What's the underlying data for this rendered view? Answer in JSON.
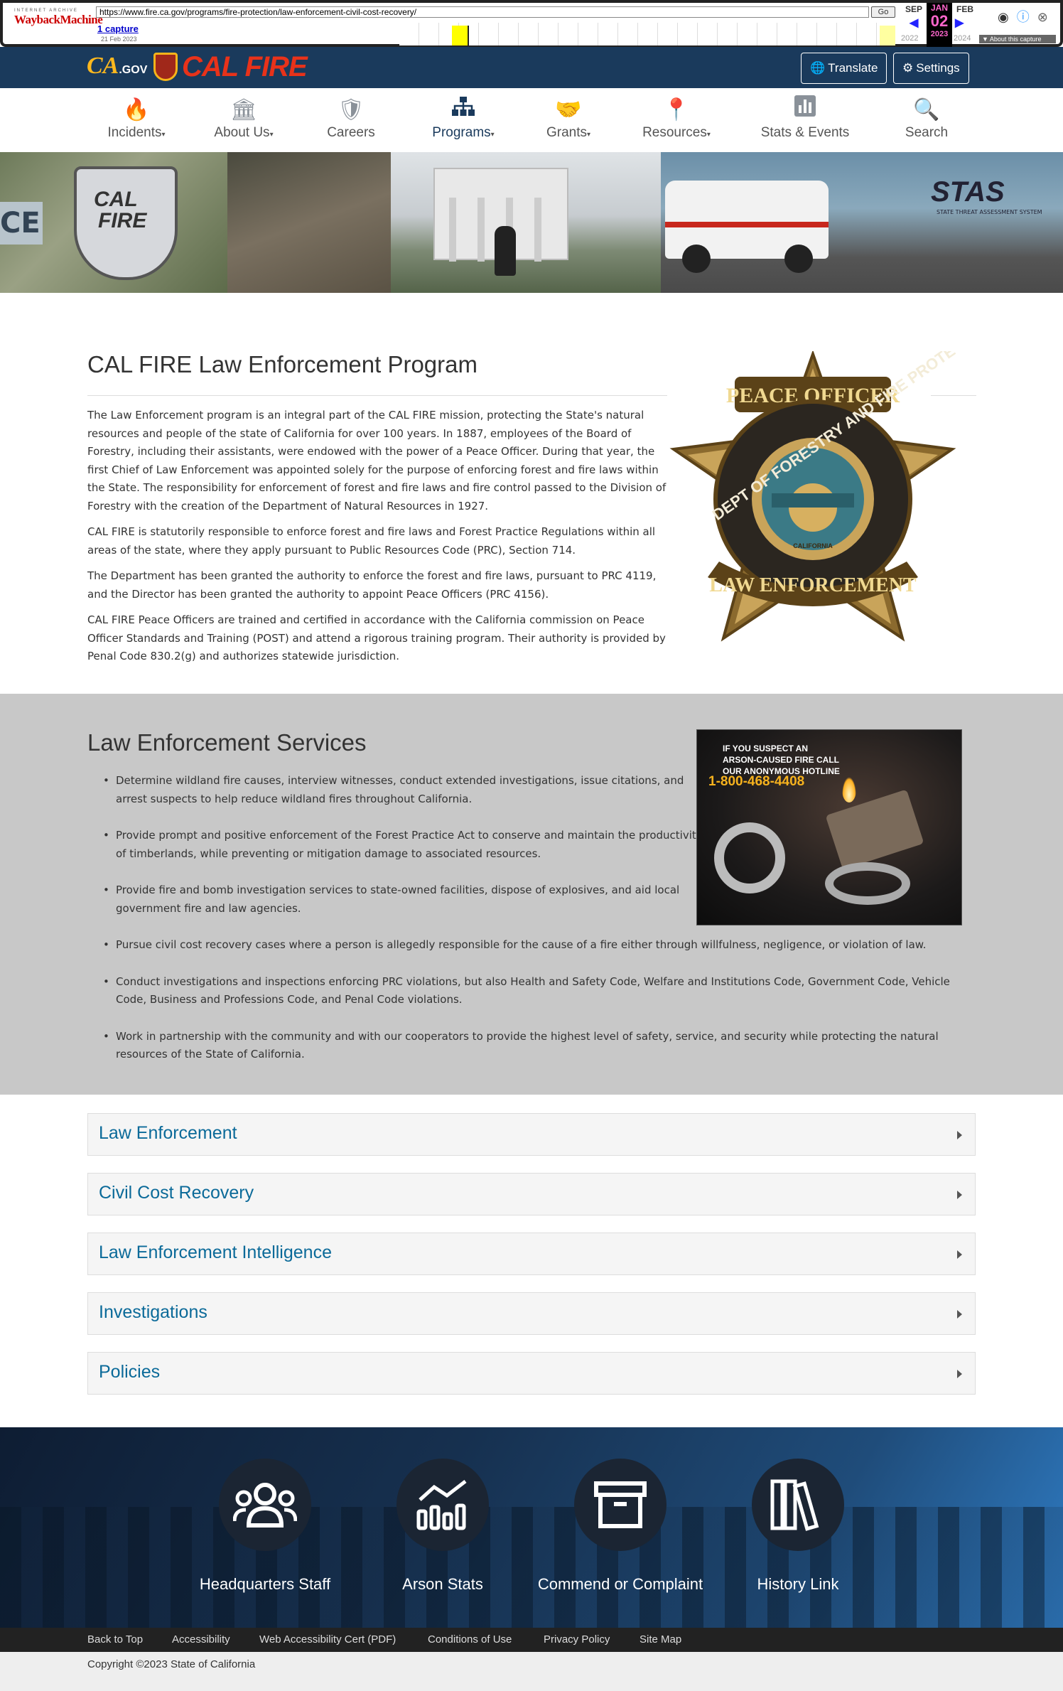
{
  "wayback": {
    "logo_top": "INTERNET ARCHIVE",
    "logo_main": "WaybackMachine",
    "url": "https://www.fire.ca.gov/programs/fire-protection/law-enforcement-civil-cost-recovery/",
    "go_label": "Go",
    "captures": "1 capture",
    "capture_date": "21 Feb 2023",
    "month_prev": "SEP",
    "month_current": "JAN",
    "day_current": "02",
    "month_next": "FEB",
    "year_prev": "2022",
    "year_current": "2023",
    "year_next": "2024",
    "about": "▼ About this capture"
  },
  "header": {
    "cagov": "CA",
    "cagov_suffix": ".GOV",
    "brand": "CAL FIRE",
    "translate_label": "Translate",
    "settings_label": "Settings"
  },
  "nav": {
    "items": [
      {
        "label": "Incidents",
        "caret": "▾",
        "icon": "flame-icon"
      },
      {
        "label": "About Us",
        "caret": "▾",
        "icon": "capitol-icon"
      },
      {
        "label": "Careers",
        "caret": "",
        "icon": "badge-icon"
      },
      {
        "label": "Programs",
        "caret": "▾",
        "icon": "sitemap-icon"
      },
      {
        "label": "Grants",
        "caret": "▾",
        "icon": "handshake-icon"
      },
      {
        "label": "Resources",
        "caret": "▾",
        "icon": "map-pin-icon"
      },
      {
        "label": "Stats & Events",
        "caret": "",
        "icon": "bar-chart-icon"
      },
      {
        "label": "Search",
        "caret": "",
        "icon": "search-icon"
      }
    ]
  },
  "banner": {
    "patch_line1": "CAL",
    "patch_line2": "FIRE",
    "ce": "CE",
    "stas": "STAS",
    "stas_sub": "STATE THREAT ASSESSMENT SYSTEM"
  },
  "intro": {
    "title": "CAL FIRE Law Enforcement Program",
    "paragraphs": [
      "The Law Enforcement program is an integral part of the CAL FIRE mission, protecting the State's natural resources and people of the state of California for over 100 years. In 1887, employees of the Board of Forestry, including their assistants, were endowed with the power of a Peace Officer. During that year, the first Chief of Law Enforcement was appointed solely for the purpose of enforcing forest and fire laws within the State. The responsibility for enforcement of forest and fire laws and fire control passed to the Division of Forestry with the creation of the Department of Natural Resources in 1927.",
      "CAL FIRE is statutorily responsible to enforce forest and fire laws and Forest Practice Regulations within all areas of the state, where they apply pursuant to Public Resources Code (PRC), Section 714.",
      "The Department has been granted the authority to enforce the forest and fire laws, pursuant to PRC 4119, and the Director has been granted the authority to appoint Peace Officers (PRC 4156).",
      "CAL FIRE Peace Officers are trained and certified in accordance with the California commission on Peace Officer Standards and Training (POST) and attend a rigorous training program. Their authority is provided by Penal Code 830.2(g) and authorizes statewide jurisdiction."
    ],
    "badge": {
      "top": "PEACE OFFICER",
      "ring_top": "DEPT OF FORESTRY AND FIRE PROTECTION",
      "bottom": "LAW ENFORCEMENT",
      "seal": "CALIFORNIA"
    }
  },
  "services": {
    "title": "Law Enforcement Services",
    "items": [
      "Determine wildland fire causes, interview witnesses, conduct extended investigations, issue citations, and arrest suspects to help reduce wildland fires throughout California.",
      "Provide prompt and positive enforcement of the Forest Practice Act to conserve and maintain the productivity of timberlands, while preventing or mitigation damage to associated resources.",
      "Provide fire and bomb investigation services to state-owned facilities, dispose of explosives, and aid local government fire and law agencies.",
      "Pursue civil cost recovery cases where a person is allegedly responsible for the cause of a fire either through willfulness, negligence, or violation of law.",
      "Conduct investigations and inspections enforcing PRC violations, but also Health and Safety Code, Welfare and Institutions Code, Government Code, Vehicle Code, Business and Professions Code, and Penal Code violations.",
      "Work in partnership with the community and with our cooperators to provide the highest level of safety, service, and security while protecting the natural resources of the State of California."
    ],
    "arson_line1": "IF YOU SUSPECT AN",
    "arson_line2": "ARSON-CAUSED FIRE CALL",
    "arson_line3": "OUR ANONYMOUS HOTLINE",
    "arson_phone": "1-800-468-4408"
  },
  "accordion": [
    {
      "label": "Law Enforcement"
    },
    {
      "label": "Civil Cost Recovery"
    },
    {
      "label": "Law Enforcement Intelligence"
    },
    {
      "label": "Investigations"
    },
    {
      "label": "Policies"
    }
  ],
  "footer_links": [
    {
      "label": "Headquarters Staff",
      "icon": "users-icon"
    },
    {
      "label": "Arson Stats",
      "icon": "chart-line-icon"
    },
    {
      "label": "Commend or Complaint",
      "icon": "archive-box-icon"
    },
    {
      "label": "History Link",
      "icon": "books-icon"
    }
  ],
  "utility": [
    "Back to Top",
    "Accessibility",
    "Web Accessibility Cert (PDF)",
    "Conditions of Use",
    "Privacy Policy",
    "Site Map"
  ],
  "copyright": "Copyright ©2023 State of California",
  "colors": {
    "header_bg": "#1a3a5c",
    "accent_link": "#0b6a99",
    "brand_red": "#e8321a",
    "services_bg": "#c8c8c8"
  }
}
